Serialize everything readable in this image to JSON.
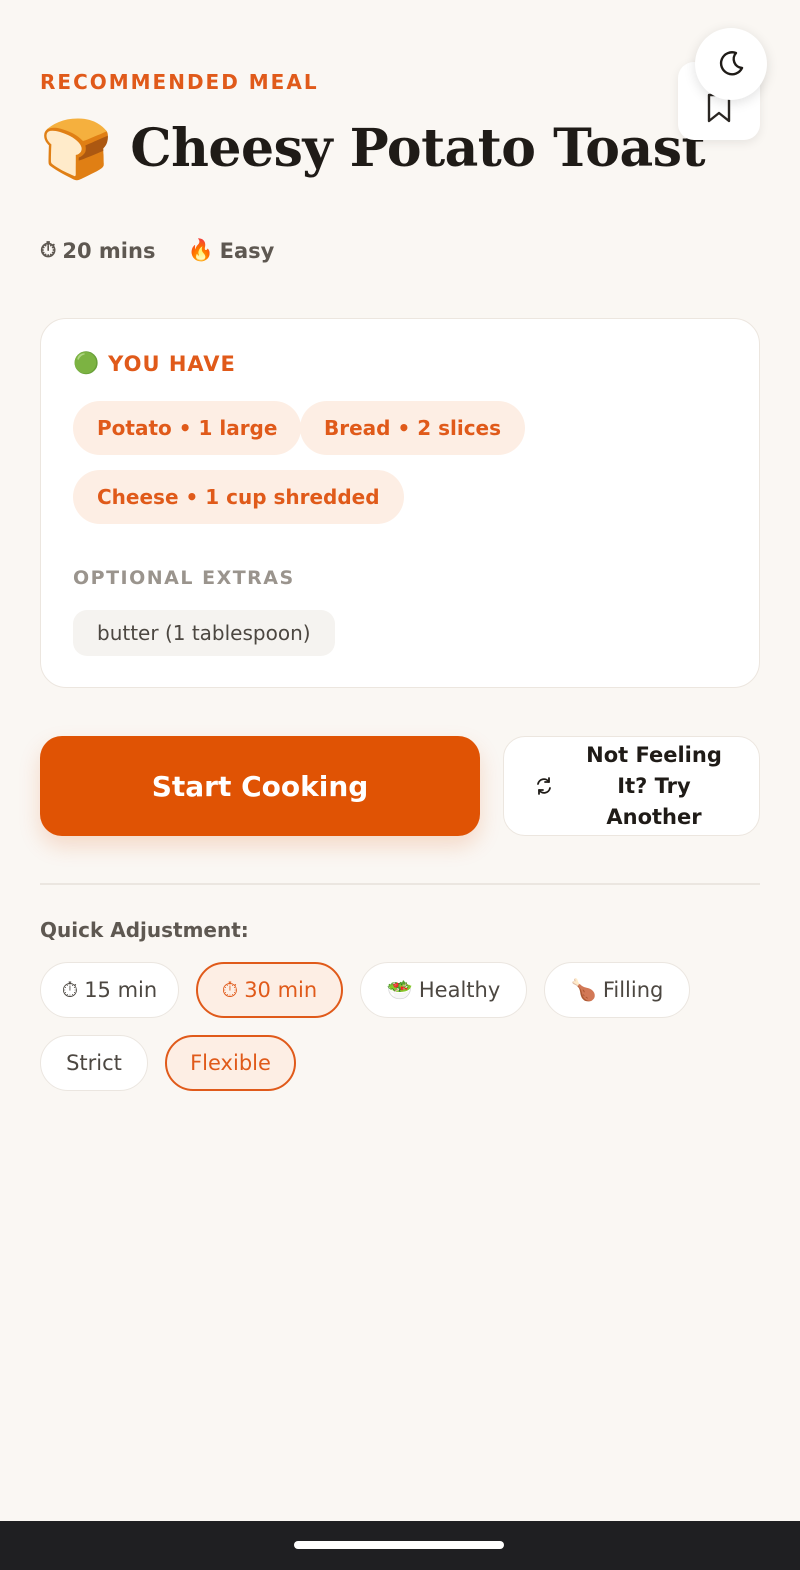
{
  "header": {
    "eyebrow": "RECOMMENDED MEAL",
    "emoji": "🍞",
    "title": "Cheesy Potato Toast"
  },
  "meta": {
    "time_icon": "⏱",
    "time": "20 mins",
    "difficulty_icon": "🔥",
    "difficulty": "Easy"
  },
  "ingredients": {
    "have_icon": "🟢",
    "have_label": "YOU HAVE",
    "have": [
      "Potato • 1 large",
      "Bread • 2 slices",
      "Cheese • 1 cup shredded"
    ],
    "optional_label": "OPTIONAL EXTRAS",
    "optional": [
      "butter (1 tablespoon)"
    ]
  },
  "actions": {
    "start": "Start Cooking",
    "another": "Not Feeling It? Try Another"
  },
  "quick_adjustment": {
    "label": "Quick Adjustment:",
    "options": [
      {
        "icon": "⏱",
        "label": "15 min",
        "active": false
      },
      {
        "icon": "⏱",
        "label": "30 min",
        "active": true
      },
      {
        "icon": "🥗",
        "label": "Healthy",
        "active": false
      },
      {
        "icon": "🍗",
        "label": "Filling",
        "active": false
      },
      {
        "icon": "",
        "label": "Strict",
        "active": false
      },
      {
        "icon": "",
        "label": "Flexible",
        "active": true
      }
    ]
  },
  "icons": {
    "theme_toggle": "moon-icon",
    "bookmark": "bookmark-icon",
    "refresh": "refresh-icon"
  },
  "colors": {
    "accent": "#e05304",
    "accent_soft": "#fdeee4",
    "background": "#faf7f3"
  }
}
